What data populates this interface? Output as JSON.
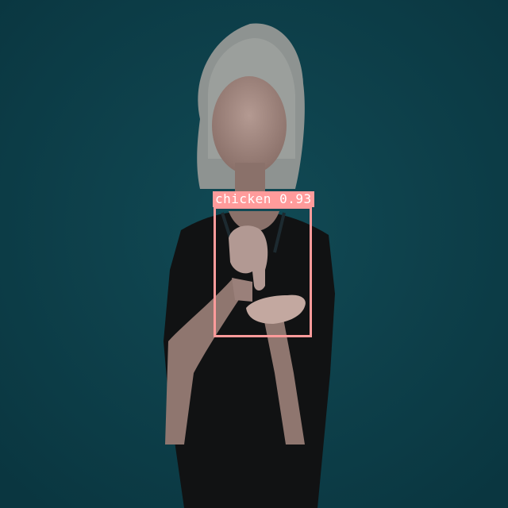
{
  "detection": {
    "label": "chicken 0.93",
    "class": "chicken",
    "confidence": 0.93,
    "box_color": "#ff9b9b"
  },
  "scene": {
    "background_color": "#0d3f4a",
    "shirt_color": "#111213",
    "hair_color": "#9a9e9c",
    "skin_color": "#a8908a"
  }
}
